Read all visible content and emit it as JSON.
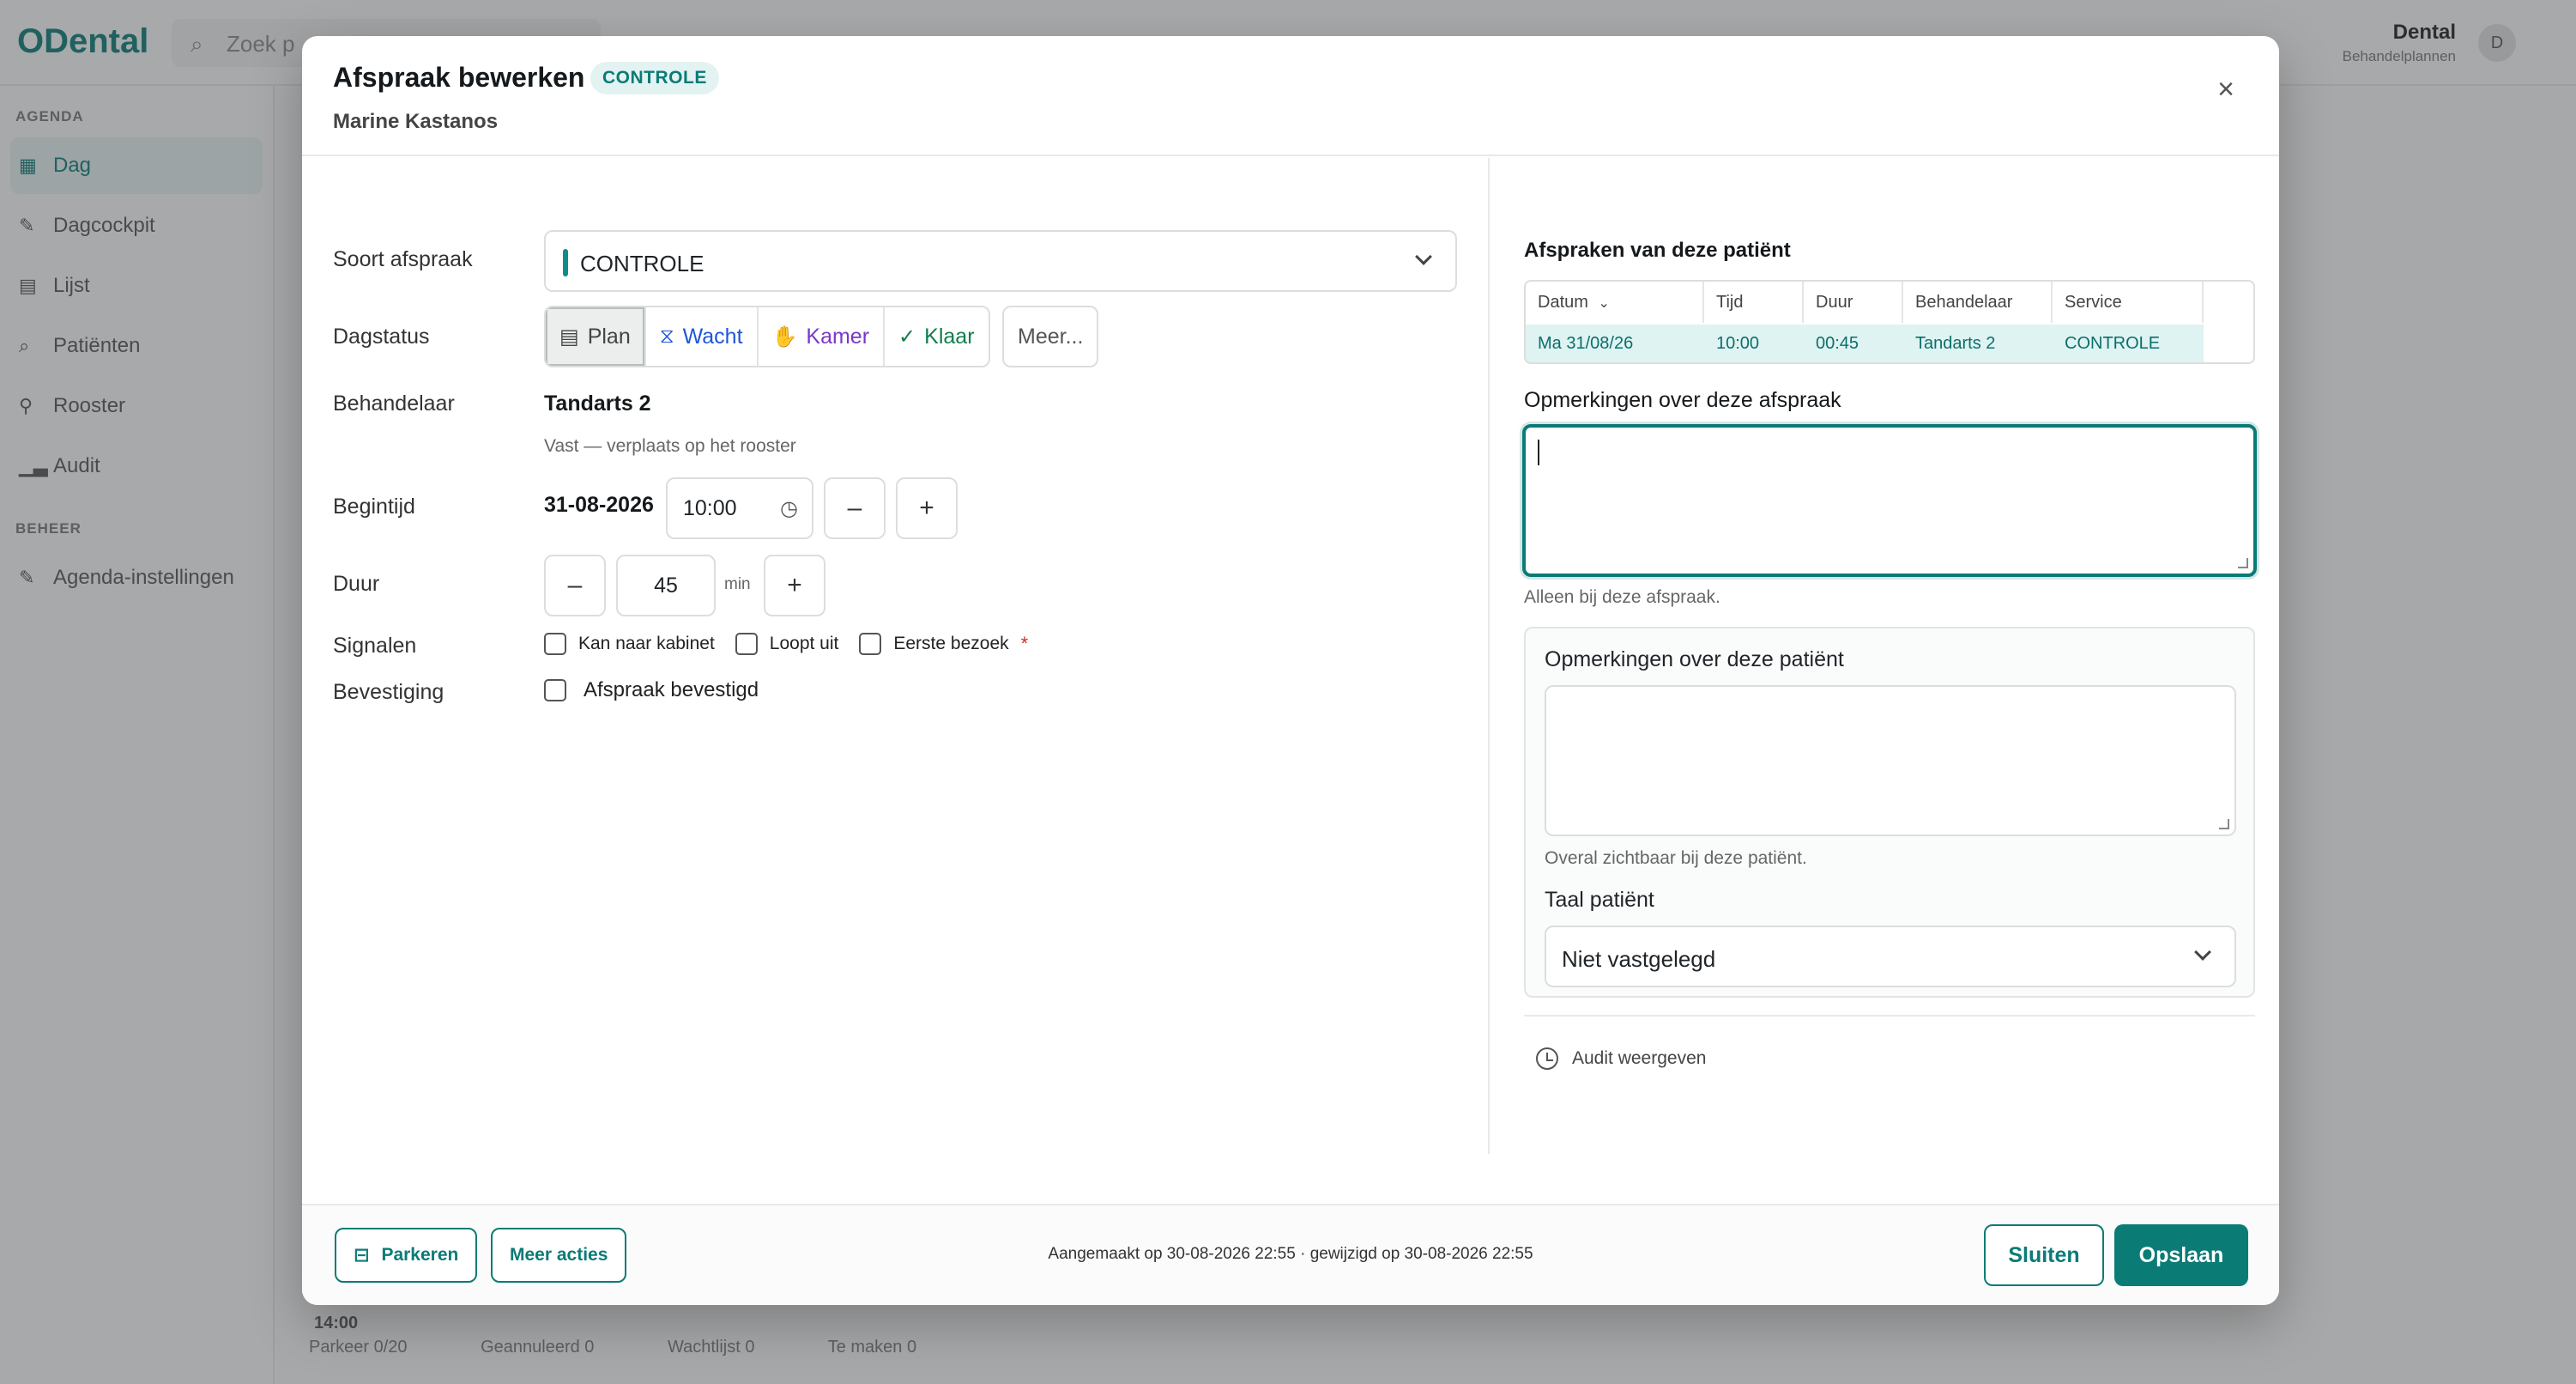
{
  "background": {
    "logo": "ODental",
    "search_placeholder": "Zoek p",
    "user_name": "Dental",
    "user_role": "Behandelplannen",
    "avatar_initial": "D",
    "sidebar": {
      "section_agenda": "AGENDA",
      "section_beheer": "BEHEER",
      "items": [
        {
          "label": "Dag",
          "icon": "calendar-icon"
        },
        {
          "label": "Dagcockpit",
          "icon": "pin-icon"
        },
        {
          "label": "Lijst",
          "icon": "document-icon"
        },
        {
          "label": "Patiënten",
          "icon": "search-icon"
        },
        {
          "label": "Rooster",
          "icon": "person-icon"
        },
        {
          "label": "Audit",
          "icon": "chart-icon"
        }
      ],
      "beheer_items": [
        {
          "label": "Agenda-instellingen",
          "icon": "pin-icon"
        }
      ]
    },
    "time_label": "14:00",
    "bottom_tabs": [
      "Parkeer 0/20",
      "Geannuleerd 0",
      "Wachtlijst 0",
      "Te maken 0"
    ]
  },
  "modal": {
    "title": "Afspraak bewerken",
    "badge": "CONTROLE",
    "patient": "Marine Kastanos",
    "close_label": "×",
    "form": {
      "type_label": "Soort afspraak",
      "type_value": "CONTROLE",
      "status_label": "Dagstatus",
      "status_options": [
        {
          "label": "Plan",
          "icon": "calendar-icon",
          "glyph": "📅"
        },
        {
          "label": "Wacht",
          "icon": "hourglass-icon",
          "glyph": "⧖"
        },
        {
          "label": "Kamer",
          "icon": "hand-icon",
          "glyph": "✋"
        },
        {
          "label": "Klaar",
          "icon": "check-icon",
          "glyph": "✓"
        }
      ],
      "status_more": "Meer...",
      "practitioner_label": "Behandelaar",
      "practitioner_value": "Tandarts 2",
      "practitioner_hint": "Vast — verplaats op het rooster",
      "start_label": "Begintijd",
      "start_date": "31-08-2026",
      "start_time": "10:00",
      "minus": "–",
      "plus": "+",
      "duration_label": "Duur",
      "duration_value": "45",
      "duration_unit": "min",
      "signals_label": "Signalen",
      "signals": [
        "Kan naar kabinet",
        "Loopt uit",
        "Eerste bezoek"
      ],
      "signals_required": "*",
      "confirm_label": "Bevestiging",
      "confirm_checkbox": "Afspraak bevestigd"
    },
    "right": {
      "appointments_title": "Afspraken van deze patiënt",
      "columns": [
        "Datum",
        "Tijd",
        "Duur",
        "Behandelaar",
        "Service"
      ],
      "rows": [
        {
          "datum": "Ma 31/08/26",
          "tijd": "10:00",
          "duur": "00:45",
          "behandelaar": "Tandarts 2",
          "service": "CONTROLE"
        }
      ],
      "appointment_notes_label": "Opmerkingen over deze afspraak",
      "appointment_notes_value": "",
      "appointment_notes_hint": "Alleen bij deze afspraak.",
      "patient_notes_label": "Opmerkingen over deze patiënt",
      "patient_notes_value": "",
      "patient_notes_hint": "Overal zichtbaar bij deze patiënt.",
      "language_label": "Taal patiënt",
      "language_value": "Niet vastgelegd",
      "audit_label": "Audit weergeven"
    },
    "footer": {
      "park_label": "Parkeren",
      "more_actions_label": "Meer acties",
      "info": "Aangemaakt op 30-08-2026 22:55 · gewijzigd op 30-08-2026 22:55",
      "close_label": "Sluiten",
      "save_label": "Opslaan"
    },
    "colors": {
      "accent": "#0b7b76",
      "wacht": "#1f56d6",
      "kamer": "#7a37c8",
      "klaar": "#0f7e4a",
      "row_highlight": "#dff3f2"
    }
  }
}
